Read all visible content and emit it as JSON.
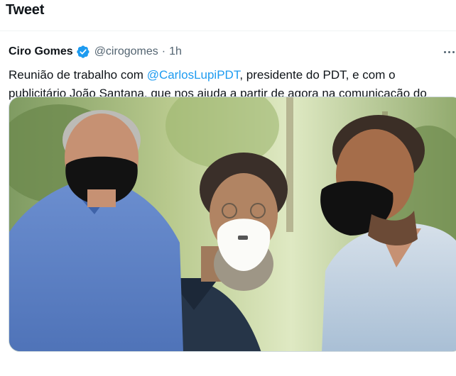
{
  "header": {
    "title": "Tweet"
  },
  "tweet": {
    "author_name": "Ciro Gomes",
    "handle": "@cirogomes",
    "separator": "·",
    "time": "1h",
    "text_before": "Reunião de trabalho com ",
    "mention": "@CarlosLupiPDT",
    "text_after": ", presidente do PDT, e com o publicitário João Santana, que nos ajuda a partir de agora na comunicação do partido."
  },
  "colors": {
    "accent": "#1d9bf0",
    "text": "#0f1419",
    "muted": "#536471",
    "verified": "#1d9bf0"
  },
  "icons": {
    "verified": "verified-badge-icon",
    "more": "more-dots-icon"
  }
}
